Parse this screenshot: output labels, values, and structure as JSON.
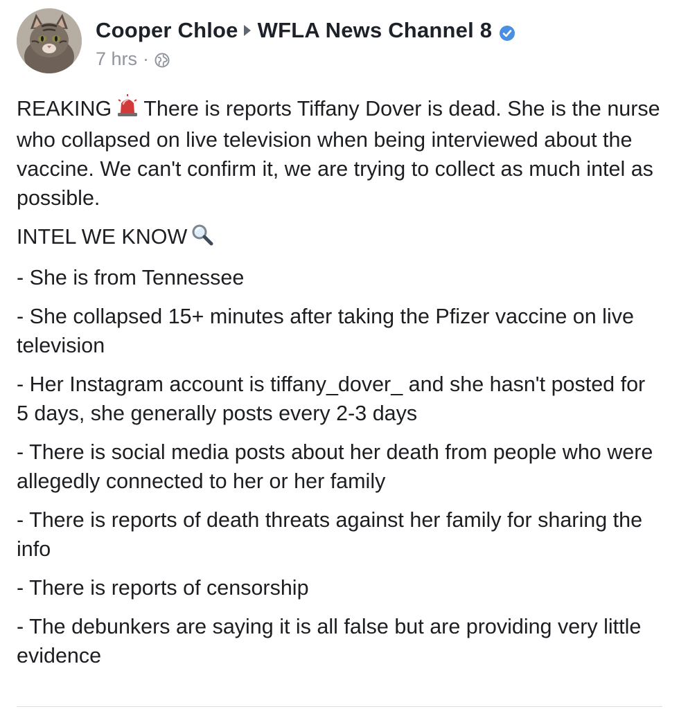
{
  "post": {
    "author": "Cooper Chloe",
    "target_page": "WFLA News Channel 8",
    "timestamp": "7 hrs",
    "separator": "·",
    "privacy_icon": "globe-icon",
    "verified_icon": "verified-badge-icon",
    "accent_color": "#4267b2"
  },
  "body": {
    "breaking_prefix": "REAKING",
    "breaking_emoji": "siren-icon",
    "breaking_text": "There is reports Tiffany Dover is dead. She is the nurse who collapsed on live television when being interviewed about the vaccine. We can't confirm it, we are trying to collect as much intel as possible.",
    "intel_heading": "INTEL WE KNOW",
    "intel_emoji": "magnifying-glass-icon",
    "bullets": [
      "- She is from Tennessee",
      "- She collapsed 15+ minutes after taking the Pfizer vaccine on live television",
      "- Her Instagram account is tiffany_dover_ and she hasn't posted for 5 days, she generally posts every 2-3 days",
      "- There is social media posts about her death from people who were allegedly connected to her or her family",
      "- There is reports of death threats against her family for sharing the info",
      "- There is reports of censorship",
      "- The debunkers are saying it is all false but are providing very little evidence"
    ]
  }
}
